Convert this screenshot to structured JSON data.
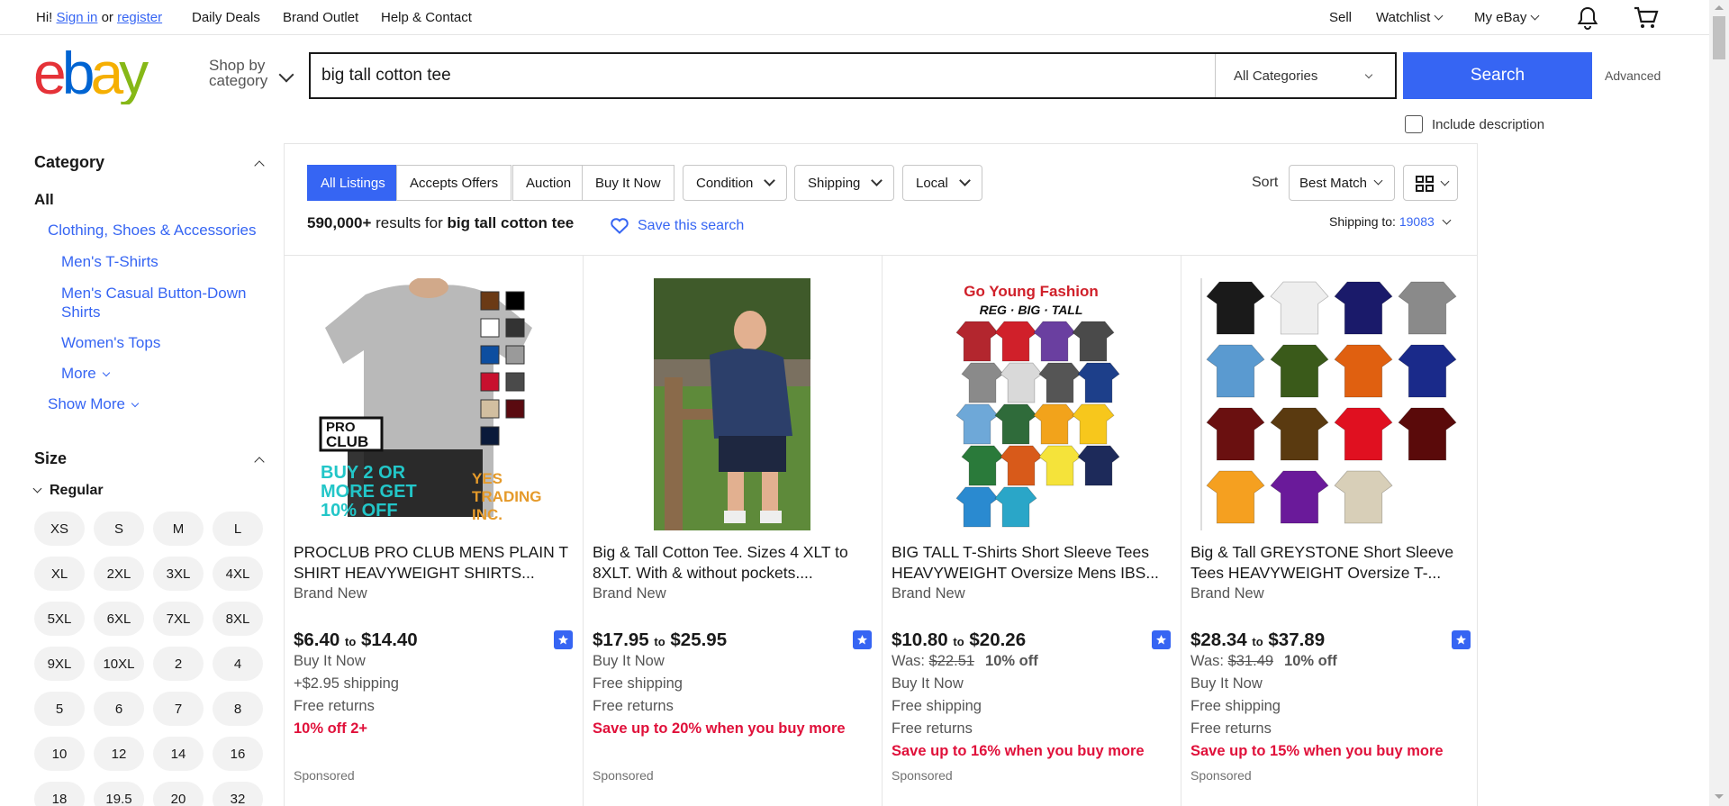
{
  "top_nav": {
    "greeting": "Hi!",
    "sign_in": "Sign in",
    "or": "or",
    "register": "register",
    "links": [
      "Daily Deals",
      "Brand Outlet",
      "Help & Contact"
    ],
    "sell": "Sell",
    "watchlist": "Watchlist",
    "my_ebay": "My eBay"
  },
  "header": {
    "logo": "ebay",
    "shop_by_category": [
      "Shop by",
      "category"
    ],
    "search_value": "big tall cotton tee",
    "category_select": "All Categories",
    "search_button": "Search",
    "advanced": "Advanced",
    "include_description": "Include description"
  },
  "sidebar": {
    "category_heading": "Category",
    "all": "All",
    "top_category": "Clothing, Shoes & Accessories",
    "subcategories": [
      "Men's T-Shirts",
      "Men's Casual Button-Down",
      "Shirts",
      "Women's Tops"
    ],
    "more": "More",
    "show_more": "Show More",
    "size_heading": "Size",
    "regular": "Regular",
    "sizes": [
      "XS",
      "S",
      "M",
      "L",
      "XL",
      "2XL",
      "3XL",
      "4XL",
      "5XL",
      "6XL",
      "7XL",
      "8XL",
      "9XL",
      "10XL",
      "2",
      "4",
      "5",
      "6",
      "7",
      "8",
      "10",
      "12",
      "14",
      "16",
      "18",
      "19.5",
      "20",
      "32"
    ]
  },
  "filters": {
    "tabs": [
      "All Listings",
      "Accepts Offers",
      "Auction",
      "Buy It Now"
    ],
    "dropdowns": [
      "Condition",
      "Shipping",
      "Local"
    ],
    "sort_label": "Sort",
    "sort_value": "Best Match"
  },
  "results": {
    "count": "590,000+",
    "results_for": "results for",
    "query": "big tall cotton tee",
    "save_search": "Save this search",
    "shipping_to": "Shipping to:",
    "zip": "19083"
  },
  "items": [
    {
      "title": "PROCLUB PRO CLUB MENS PLAIN T SHIRT HEAVYWEIGHT SHIRTS...",
      "condition": "Brand New",
      "price_low": "$6.40",
      "to": "to",
      "price_high": "$14.40",
      "lines": [
        "Buy It Now",
        "+$2.95 shipping",
        "Free returns"
      ],
      "promo": "10% off 2+",
      "sponsored": "Sponsored",
      "image_text": [
        "PRO",
        "CLUB",
        "BUY 2 OR",
        "MORE GET",
        "10% OFF",
        "YES",
        "TRADING",
        "INC."
      ]
    },
    {
      "title": "Big & Tall Cotton Tee. Sizes 4 XLT to 8XLT. With & without pockets....",
      "condition": "Brand New",
      "price_low": "$17.95",
      "to": "to",
      "price_high": "$25.95",
      "lines": [
        "Buy It Now",
        "Free shipping",
        "Free returns"
      ],
      "promo": "Save up to 20% when you buy more",
      "sponsored": "Sponsored"
    },
    {
      "title": "BIG TALL T-Shirts Short Sleeve Tees HEAVYWEIGHT Oversize Mens IBS...",
      "condition": "Brand New",
      "price_low": "$10.80",
      "to": "to",
      "price_high": "$20.26",
      "was_label": "Was:",
      "was": "$22.51",
      "off": "10% off",
      "lines": [
        "Buy It Now",
        "Free shipping",
        "Free returns"
      ],
      "promo": "Save up to 16% when you buy more",
      "sponsored": "Sponsored",
      "image_text": [
        "Go Young Fashion",
        "REG · BIG · TALL"
      ]
    },
    {
      "title": "Big & Tall GREYSTONE Short Sleeve Tees HEAVYWEIGHT Oversize T-...",
      "condition": "Brand New",
      "price_low": "$28.34",
      "to": "to",
      "price_high": "$37.89",
      "was_label": "Was:",
      "was": "$31.49",
      "off": "10% off",
      "lines": [
        "Buy It Now",
        "Free shipping",
        "Free returns"
      ],
      "promo": "Save up to 15% when you buy more",
      "sponsored": "Sponsored"
    }
  ],
  "colors": {
    "ebay_red": "#e53238",
    "ebay_blue": "#0064d2",
    "ebay_yellow": "#f5af02",
    "ebay_green": "#86b817",
    "accent": "#3665f3",
    "promo": "#e0103a"
  },
  "shirt_colors": {
    "item1_swatches": [
      "#6b3a15",
      "#000000",
      "#ffffff",
      "#333333",
      "#0d4ea0",
      "#9a9a9a",
      "#c8102e",
      "#4a4a4a",
      "#d2bfa0",
      "#5a0a10",
      "#0a1a3a"
    ],
    "item3_grid": [
      "#b3262e",
      "#d0202a",
      "#6a3fa0",
      "#4a4a4a",
      "#8a8a8a",
      "#d9d9d9",
      "#555555",
      "#1d3f8a",
      "#6ea8d8",
      "#2f6b3a",
      "#f2a31b",
      "#f7c71c",
      "#2a7a3a",
      "#d85a1a",
      "#f5e33a",
      "#1d2a5a",
      "#2a8ad0",
      "#2aa6c8"
    ],
    "item4_grid": [
      "#1a1a1a",
      "#eeeeee",
      "#1a1a6a",
      "#8a8a8a",
      "#5a9ad0",
      "#3a5a1a",
      "#e06010",
      "#1a2a8a",
      "#6a1010",
      "#5a3a10",
      "#e01020",
      "#5a0a0a",
      "#f5a020",
      "#6a1a9a",
      "#d8cfb8"
    ]
  }
}
